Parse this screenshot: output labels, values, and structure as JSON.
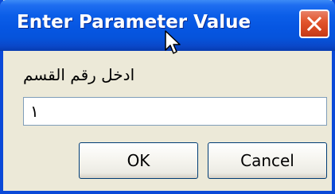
{
  "window": {
    "title": "Enter Parameter Value",
    "close_icon": "close-icon"
  },
  "prompt": {
    "label": "ادخل رقم القسم"
  },
  "parameter_input": {
    "value": "١"
  },
  "buttons": {
    "ok_label": "OK",
    "cancel_label": "Cancel"
  },
  "colors": {
    "titlebar": "#0656e2",
    "close_button": "#e2562e",
    "dialog_background": "#ece9d8"
  }
}
